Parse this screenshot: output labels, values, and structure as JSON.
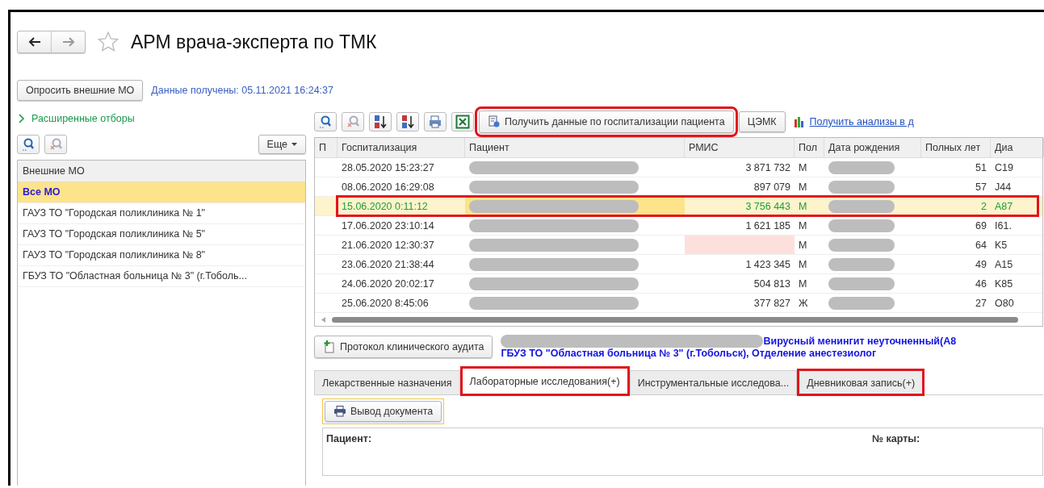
{
  "window": {
    "title": "АРМ врача-эксперта по ТМК"
  },
  "poll_button": "Опросить внешние МО",
  "data_received": "Данные получены: 05.11.2021 16:24:37",
  "advanced_filters": "Расширенные отборы",
  "more_button": "Еще",
  "mo_list": {
    "header": "Внешние МО",
    "items": [
      {
        "label": "Все МО",
        "selected": true
      },
      {
        "label": "ГАУЗ ТО \"Городская поликлиника № 1\"",
        "selected": false
      },
      {
        "label": "ГАУЗ ТО \"Городская поликлиника № 5\"",
        "selected": false
      },
      {
        "label": "ГАУЗ ТО \"Городская поликлиника № 8\"",
        "selected": false
      },
      {
        "label": "ГБУЗ ТО \"Областная больница № 3\" (г.Тоболь...",
        "selected": false
      }
    ]
  },
  "toolbar": {
    "get_data_button": {
      "label": "Получить данные по госпитализации пациента",
      "highlighted": true
    },
    "cemk_button": "ЦЭМК",
    "analyses_link": "Получить анализы в д"
  },
  "table": {
    "columns": [
      "П",
      "Госпитализация",
      "Пациент",
      "РМИС",
      "Пол",
      "Дата рождения",
      "Полных лет",
      "Диа"
    ],
    "rows": [
      {
        "date": "28.05.2020 15:23:27",
        "patient_redacted": true,
        "rmis": "3 871 732",
        "sex": "М",
        "birth_redacted": true,
        "age": "51",
        "diag": "C19",
        "selected": false,
        "highlighted": false
      },
      {
        "date": "08.06.2020 16:29:08",
        "patient_redacted": true,
        "rmis": "897 079",
        "sex": "М",
        "birth_redacted": true,
        "age": "57",
        "diag": "J44",
        "selected": false,
        "highlighted": false
      },
      {
        "date": "15.06.2020 0:11:12",
        "patient_redacted": true,
        "rmis": "3 756 443",
        "sex": "М",
        "birth_redacted": true,
        "age": "2",
        "diag": "A87",
        "selected": true,
        "highlighted": true
      },
      {
        "date": "17.06.2020 23:10:14",
        "patient_redacted": true,
        "rmis": "1 621 185",
        "sex": "М",
        "birth_redacted": true,
        "age": "69",
        "diag": "I61.",
        "selected": false,
        "highlighted": false
      },
      {
        "date": "21.06.2020 12:30:37",
        "patient_redacted": true,
        "sex": "М",
        "birth_redacted": true,
        "age": "64",
        "diag": "K5",
        "selected": false,
        "highlighted": false
      },
      {
        "date": "23.06.2020 21:38:44",
        "patient_redacted": true,
        "rmis": "1 423 345",
        "sex": "М",
        "birth_redacted": true,
        "age": "49",
        "diag": "A15",
        "selected": false,
        "highlighted": false
      },
      {
        "date": "24.06.2020 20:02:17",
        "patient_redacted": true,
        "rmis": "504 813",
        "sex": "М",
        "birth_redacted": true,
        "age": "46",
        "diag": "K85",
        "selected": false,
        "highlighted": false
      },
      {
        "date": "25.06.2020 8:45:06",
        "patient_redacted": true,
        "rmis": "377 827",
        "sex": "Ж",
        "birth_redacted": true,
        "age": "27",
        "diag": "O80",
        "selected": false,
        "highlighted": false
      }
    ]
  },
  "audit_button": "Протокол клинического аудита",
  "info": {
    "diagnosis": "Вирусный менингит неуточненный(А8",
    "organization": "ГБУЗ ТО \"Областная больница № 3\" (г.Тобольск), Отделение анестезиолог"
  },
  "tabs": [
    {
      "label": "Лекарственные назначения",
      "selected": false,
      "highlighted": false
    },
    {
      "label": "Лабораторные исследования(+)",
      "selected": true,
      "highlighted": true
    },
    {
      "label": "Инструментальные исследова...",
      "selected": false,
      "highlighted": false
    },
    {
      "label": "Дневниковая запись(+)",
      "selected": false,
      "highlighted": true
    }
  ],
  "print_button": "Вывод документа",
  "form": {
    "patient_label": "Пациент:",
    "card_label": "№ карты:"
  }
}
